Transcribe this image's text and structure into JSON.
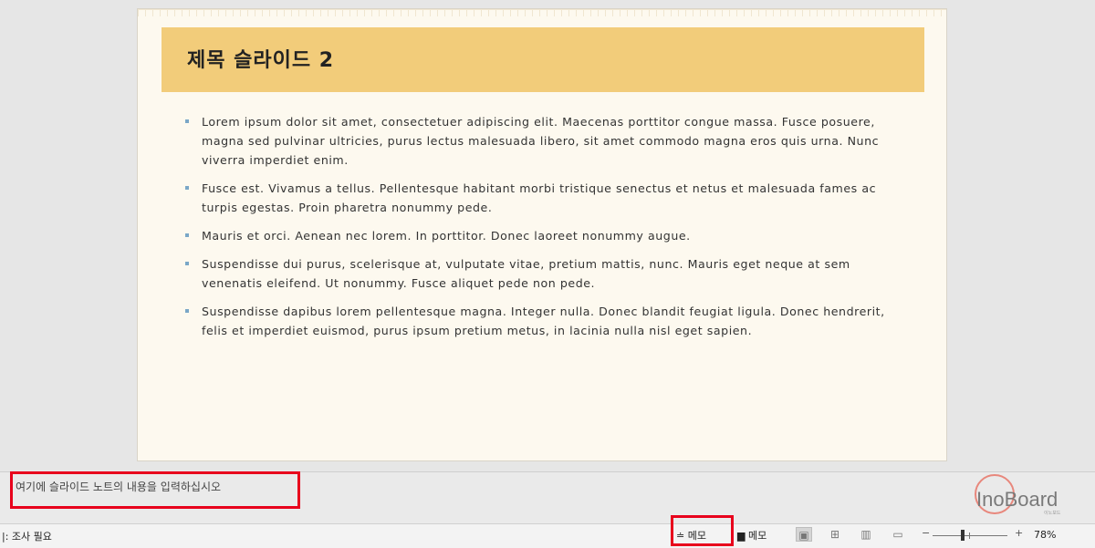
{
  "slide": {
    "title": "제목 슬라이드 2",
    "bullets": [
      "Lorem ipsum dolor sit amet, consectetuer adipiscing elit. Maecenas porttitor congue massa. Fusce posuere, magna sed pulvinar ultricies, purus lectus malesuada libero, sit amet commodo magna eros quis urna. Nunc viverra imperdiet enim.",
      "Fusce est. Vivamus a tellus. Pellentesque habitant morbi tristique senectus et netus et malesuada fames ac turpis egestas. Proin pharetra nonummy pede.",
      "Mauris et orci. Aenean nec lorem. In porttitor. Donec laoreet nonummy augue.",
      "Suspendisse dui purus, scelerisque at, vulputate vitae, pretium mattis, nunc. Mauris eget neque at sem venenatis eleifend. Ut nonummy. Fusce aliquet pede non pede.",
      "Suspendisse dapibus lorem pellentesque magna. Integer nulla. Donec blandit feugiat ligula. Donec hendrerit, felis et imperdiet euismod, purus ipsum pretium metus, in lacinia nulla nisl eget sapien."
    ],
    "title_band_color": "#f2cc7a",
    "bullet_color": "#7aa7c7"
  },
  "notes": {
    "placeholder": "여기에 슬라이드 노트의 내용을 입력하십시오"
  },
  "logo": {
    "text": "InoBoard",
    "subtext": "이노보드"
  },
  "statusbar": {
    "left_text": "|: 조사 필요",
    "memo_label": "메모",
    "comment_label": "메모",
    "zoom_minus": "−",
    "zoom_plus": "+",
    "zoom_percent": "78%",
    "zoom_level": 0.4
  },
  "highlight_color": "#e8001c"
}
